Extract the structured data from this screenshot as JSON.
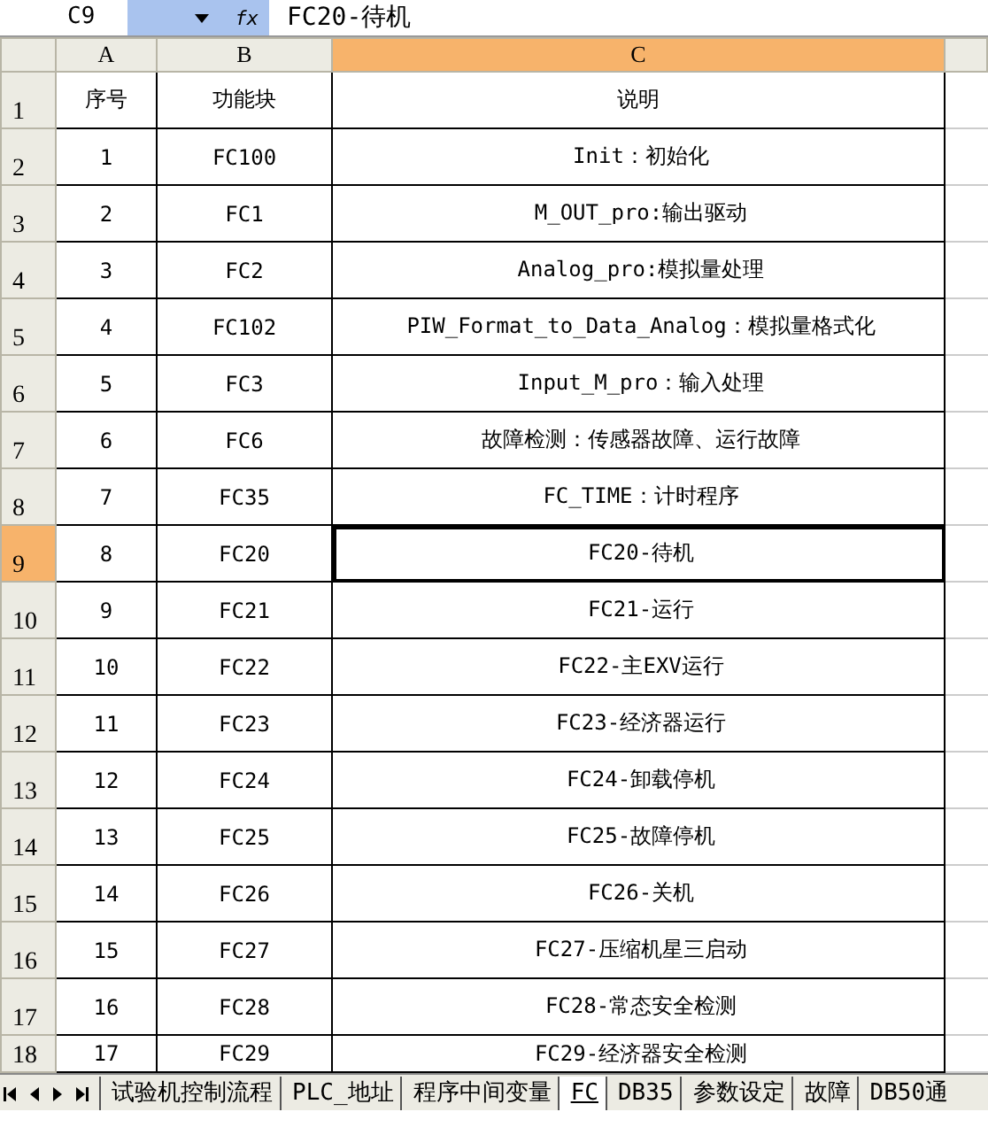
{
  "formula_bar": {
    "name_box": "C9",
    "function_label": "fx",
    "formula": "FC20-待机"
  },
  "columns": [
    {
      "label": "A",
      "selected": false
    },
    {
      "label": "B",
      "selected": false
    },
    {
      "label": "C",
      "selected": true
    }
  ],
  "rows": [
    {
      "number": "1",
      "cells": [
        "序号",
        "功能块",
        "说明"
      ],
      "selected": false
    },
    {
      "number": "2",
      "cells": [
        "1",
        "FC100",
        "Init：初始化"
      ],
      "selected": false
    },
    {
      "number": "3",
      "cells": [
        "2",
        "FC1",
        "M_OUT_pro:输出驱动"
      ],
      "selected": false
    },
    {
      "number": "4",
      "cells": [
        "3",
        "FC2",
        "Analog_pro:模拟量处理"
      ],
      "selected": false
    },
    {
      "number": "5",
      "cells": [
        "4",
        "FC102",
        "PIW_Format_to_Data_Analog：模拟量格式化"
      ],
      "selected": false
    },
    {
      "number": "6",
      "cells": [
        "5",
        "FC3",
        "Input_M_pro：输入处理"
      ],
      "selected": false
    },
    {
      "number": "7",
      "cells": [
        "6",
        "FC6",
        "故障检测：传感器故障、运行故障"
      ],
      "selected": false
    },
    {
      "number": "8",
      "cells": [
        "7",
        "FC35",
        "FC_TIME：计时程序"
      ],
      "selected": false
    },
    {
      "number": "9",
      "cells": [
        "8",
        "FC20",
        "FC20-待机"
      ],
      "selected": true
    },
    {
      "number": "10",
      "cells": [
        "9",
        "FC21",
        "FC21-运行"
      ],
      "selected": false
    },
    {
      "number": "11",
      "cells": [
        "10",
        "FC22",
        "FC22-主EXV运行"
      ],
      "selected": false
    },
    {
      "number": "12",
      "cells": [
        "11",
        "FC23",
        "FC23-经济器运行"
      ],
      "selected": false
    },
    {
      "number": "13",
      "cells": [
        "12",
        "FC24",
        "FC24-卸载停机"
      ],
      "selected": false
    },
    {
      "number": "14",
      "cells": [
        "13",
        "FC25",
        "FC25-故障停机"
      ],
      "selected": false
    },
    {
      "number": "15",
      "cells": [
        "14",
        "FC26",
        "FC26-关机"
      ],
      "selected": false
    },
    {
      "number": "16",
      "cells": [
        "15",
        "FC27",
        "FC27-压缩机星三启动"
      ],
      "selected": false
    },
    {
      "number": "17",
      "cells": [
        "16",
        "FC28",
        "FC28-常态安全检测"
      ],
      "selected": false
    },
    {
      "number": "18",
      "cells": [
        "17",
        "FC29",
        "FC29-经济器安全检测"
      ],
      "selected": false
    }
  ],
  "sheet_tabs": [
    {
      "label": "试验机控制流程",
      "selected": false
    },
    {
      "label": "PLC_地址",
      "selected": false
    },
    {
      "label": "程序中间变量",
      "selected": false
    },
    {
      "label": "FC",
      "selected": true
    },
    {
      "label": "DB35",
      "selected": false
    },
    {
      "label": "参数设定",
      "selected": false
    },
    {
      "label": "故障",
      "selected": false
    },
    {
      "label": "DB50通",
      "selected": false
    }
  ]
}
